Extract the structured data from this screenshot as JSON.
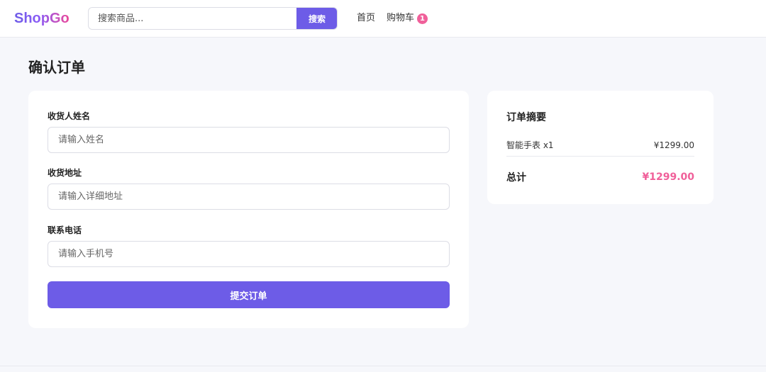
{
  "header": {
    "logo": "ShopGo",
    "search": {
      "placeholder": "搜索商品...",
      "value": "",
      "button_label": "搜索"
    },
    "nav": {
      "home": "首页",
      "cart": "购物车",
      "cart_count": "1"
    }
  },
  "page": {
    "title": "确认订单"
  },
  "form": {
    "fields": [
      {
        "label": "收货人姓名",
        "placeholder": "请输入姓名",
        "value": ""
      },
      {
        "label": "收货地址",
        "placeholder": "请输入详细地址",
        "value": ""
      },
      {
        "label": "联系电话",
        "placeholder": "请输入手机号",
        "value": ""
      }
    ],
    "submit_label": "提交订单"
  },
  "summary": {
    "title": "订单摘要",
    "items": [
      {
        "name": "智能手表 x1",
        "price": "¥1299.00"
      }
    ],
    "total_label": "总计",
    "total_value": "¥1299.00"
  },
  "colors": {
    "accent": "#6d5ce7",
    "pink": "#f0609a",
    "background": "#f6f7fb"
  }
}
